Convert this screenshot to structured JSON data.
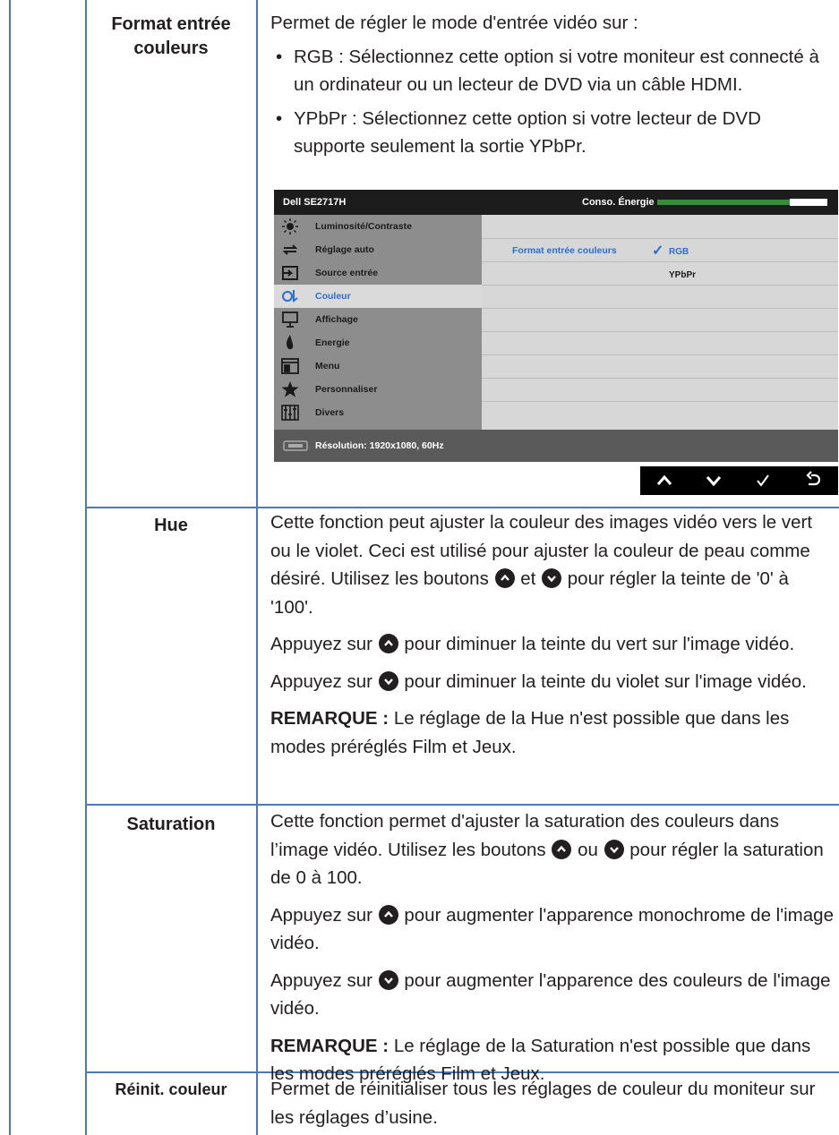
{
  "rows": [
    {
      "label": "Format entrée couleurs",
      "intro": "Permet de régler le mode d'entrée vidéo sur :",
      "bullet1": "RGB : Sélectionnez cette option si votre moniteur est connecté à un ordinateur ou un lecteur de DVD via un câble HDMI.",
      "bullet2": "YPbPr : Sélectionnez cette option si votre lecteur de DVD supporte seulement la sortie YPbPr."
    },
    {
      "label": "Hue",
      "p1a": "Cette fonction peut ajuster la couleur des images vidéo vers le vert ou le violet. Ceci est utilisé pour ajuster la couleur de peau comme désiré. Utilisez les boutons",
      "p1b": "et",
      "p1c": "pour régler la teinte de '0' à '100'.",
      "p2a": "Appuyez sur",
      "p2b": "pour diminuer la teinte du vert sur l'image vidéo.",
      "p3a": "Appuyez sur",
      "p3b": "pour diminuer la teinte du violet sur l'image vidéo.",
      "note_label": "REMARQUE :",
      "note": "Le réglage de la Hue n'est possible que dans les modes préréglés Film et Jeux."
    },
    {
      "label": "Saturation",
      "p1a": "Cette fonction permet d'ajuster la saturation des couleurs dans l’image vidéo. Utilisez les boutons",
      "p1b": "ou",
      "p1c": "pour régler la saturation de 0 à 100.",
      "p2a": "Appuyez sur",
      "p2b": "pour augmenter l'apparence monochrome de l'image vidéo.",
      "p3a": "Appuyez sur",
      "p3b": "pour augmenter l'apparence des couleurs de l'image vidéo.",
      "note_label": "REMARQUE :",
      "note": "Le réglage de la Saturation n'est possible que dans les modes préréglés Film et Jeux."
    },
    {
      "label": "Réinit. couleur",
      "text": "Permet de réinitialiser tous les réglages de couleur du moniteur sur les réglages d’usine."
    }
  ],
  "osd": {
    "model": "Dell SE2717H",
    "energy_label": "Conso. Énergie",
    "menu": [
      {
        "label": "Luminosité/Contraste",
        "icon": "brightness-icon"
      },
      {
        "label": "Réglage auto",
        "icon": "auto-adjust-icon"
      },
      {
        "label": "Source entrée",
        "icon": "input-source-icon"
      },
      {
        "label": "Couleur",
        "icon": "color-icon",
        "selected": true
      },
      {
        "label": "Affichage",
        "icon": "display-icon"
      },
      {
        "label": "Energie",
        "icon": "energy-icon"
      },
      {
        "label": "Menu",
        "icon": "menu-icon"
      },
      {
        "label": "Personnaliser",
        "icon": "star-icon"
      },
      {
        "label": "Divers",
        "icon": "others-icon"
      }
    ],
    "submenu_label": "Format entrée couleurs",
    "option_rgb": "RGB",
    "option_ypbpr": "YPbPr",
    "check": "✓",
    "resolution": "Résolution: 1920x1080, 60Hz"
  },
  "nav_buttons": [
    "up-icon",
    "down-icon",
    "check-icon",
    "back-icon"
  ],
  "colors": {
    "rule": "#4f7ab0",
    "osd_accent": "#2a6fcf",
    "icon_bg": "#231f20"
  }
}
